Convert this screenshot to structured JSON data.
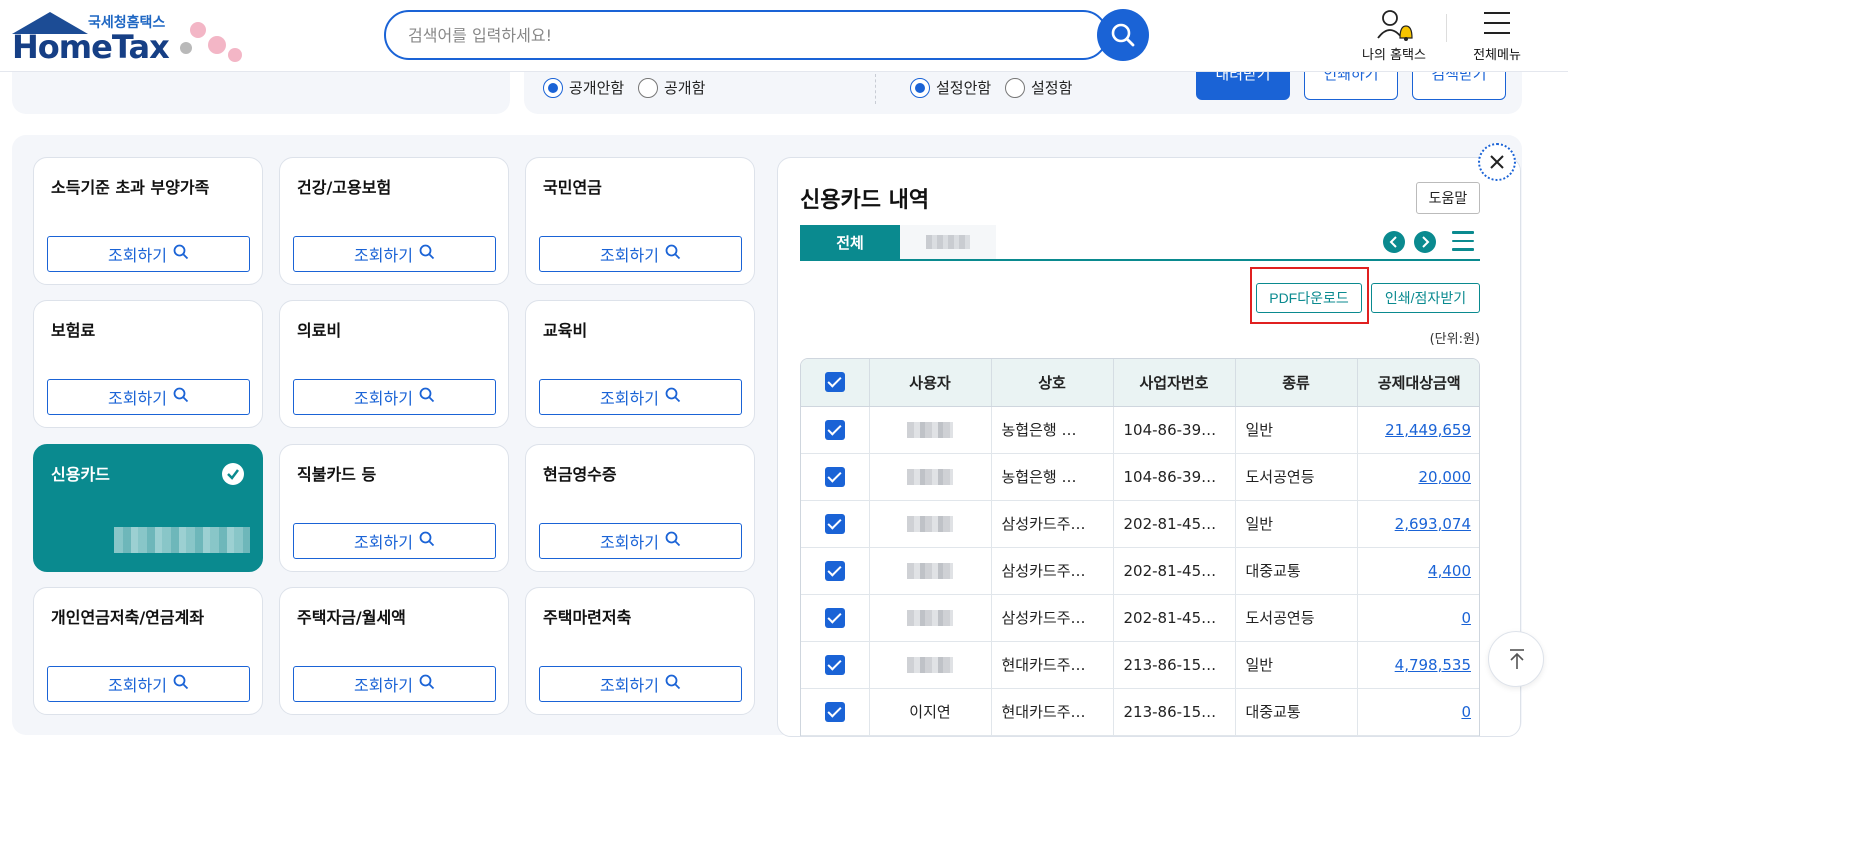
{
  "header": {
    "logo_gov_text": "국세청홈택스",
    "logo_brand_text": "HomeTax",
    "search_placeholder": "검색어를 입력하세요!",
    "my_hometax_label": "나의 홈택스",
    "all_menu_label": "전체메뉴"
  },
  "settings": {
    "group1": [
      {
        "label": "공개안함",
        "selected": true
      },
      {
        "label": "공개함",
        "selected": false
      }
    ],
    "group2": [
      {
        "label": "설정안함",
        "selected": true
      },
      {
        "label": "설정함",
        "selected": false
      }
    ],
    "buttons": [
      "내려받기",
      "인쇄하기",
      "검색받기"
    ]
  },
  "categories": [
    {
      "title": "소득기준 초과 부양가족",
      "button": "조회하기"
    },
    {
      "title": "건강/고용보험",
      "button": "조회하기"
    },
    {
      "title": "국민연금",
      "button": "조회하기"
    },
    {
      "title": "보험료",
      "button": "조회하기"
    },
    {
      "title": "의료비",
      "button": "조회하기"
    },
    {
      "title": "교육비",
      "button": "조회하기"
    },
    {
      "title": "신용카드",
      "button": "",
      "selected": true
    },
    {
      "title": "직불카드 등",
      "button": "조회하기"
    },
    {
      "title": "현금영수증",
      "button": "조회하기"
    },
    {
      "title": "개인연금저축/연금계좌",
      "button": "조회하기"
    },
    {
      "title": "주택자금/월세액",
      "button": "조회하기"
    },
    {
      "title": "주택마련저축",
      "button": "조회하기"
    }
  ],
  "detail": {
    "title": "신용카드 내역",
    "help_label": "도움말",
    "tabs": [
      "전체"
    ],
    "pdf_download_label": "PDF다운로드",
    "print_label": "인쇄/점자받기",
    "unit_label": "(단위:원)",
    "columns": [
      "사용자",
      "상호",
      "사업자번호",
      "종류",
      "공제대상금액"
    ],
    "rows": [
      {
        "user": "",
        "store": "농협은행 …",
        "bizno": "104-86-39…",
        "kind": "일반",
        "amount": "21,449,659"
      },
      {
        "user": "",
        "store": "농협은행 …",
        "bizno": "104-86-39…",
        "kind": "도서공연등",
        "amount": "20,000"
      },
      {
        "user": "",
        "store": "삼성카드주…",
        "bizno": "202-81-45…",
        "kind": "일반",
        "amount": "2,693,074"
      },
      {
        "user": "",
        "store": "삼성카드주…",
        "bizno": "202-81-45…",
        "kind": "대중교통",
        "amount": "4,400"
      },
      {
        "user": "",
        "store": "삼성카드주…",
        "bizno": "202-81-45…",
        "kind": "도서공연등",
        "amount": "0"
      },
      {
        "user": "",
        "store": "현대카드주…",
        "bizno": "213-86-15…",
        "kind": "일반",
        "amount": "4,798,535"
      },
      {
        "user": "이지연",
        "store": "현대카드주…",
        "bizno": "213-86-15…",
        "kind": "대중교통",
        "amount": "0"
      }
    ]
  },
  "colors": {
    "primary": "#1a63d6",
    "teal": "#0a8a8f",
    "highlight": "#e02020"
  },
  "icons": [
    "search-icon",
    "user-bell-icon",
    "hamburger-icon",
    "close-icon",
    "chevron-left-icon",
    "chevron-right-icon",
    "list-menu-icon",
    "check-icon",
    "arrow-up-icon"
  ]
}
